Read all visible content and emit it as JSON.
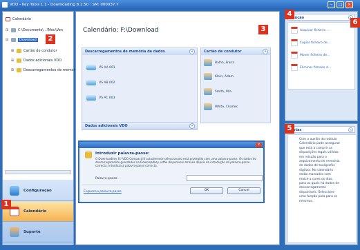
{
  "window": {
    "title": "VDO - Key Tools 1.1 - Downloading 8.1.50 : SM: 000037.7"
  },
  "tree": {
    "items": [
      {
        "label": "Calendário"
      },
      {
        "label": "C:\\Documents\\...\\Meu\\Ven"
      },
      {
        "label": "Download"
      },
      {
        "label": "Cartão de condutor"
      },
      {
        "label": "Dados adicionais VDO"
      },
      {
        "label": "Descarregamentos de memória"
      }
    ]
  },
  "nav": {
    "configuracao": "Configuração",
    "calendario": "Calendário",
    "suporte": "Suporte"
  },
  "main": {
    "title": "Calendário: F:\\Download",
    "memory": {
      "header": "Descarregamentos de memória de dados",
      "items": [
        "VS AA 001",
        "VS AB 002",
        "VS AC 003"
      ]
    },
    "cards": {
      "header": "Cartão de condutor",
      "items": [
        "Balha, Franz",
        "Klein, Adam",
        "Smith, Mia",
        "White, Charles"
      ]
    },
    "extra": {
      "header": "Dados adicionais VDO"
    }
  },
  "dialog": {
    "heading": "Introduzir palavra-passe:",
    "message": "O Downloadkey 8 / VDO Compact III actualmente seleccionado está protegido com uma palavra-passe. Os dados do descarregamento guardados no Downloadkey estão disponíveis através depois da introdução da palavra-passe correcta. Introduza a palavra-passe correcta.",
    "password_label": "Palavra-passe:",
    "forgot_link": "Esqueceu palavra-passe",
    "ok": "OK",
    "cancel": "Cancel"
  },
  "tasks": {
    "header": "Função",
    "items": [
      "Arquivar ficheiro ...",
      "Copiar ficheiro de...",
      "Mover ficheiro de...",
      "Eliminar ficheiro d..."
    ]
  },
  "notes": {
    "header": "Notas",
    "text": "Com o auxílio do módulo Calendário pode assegurar que está a cumprir as disposições legais válidas em relação para o arquivamento de memória de dados de tacógrafos digitais. No calendário estão marcados com realce a cores os dias, para os quais há dados de descarregamento disponíveis. Seleccione uma função para para os mesmos."
  },
  "badges": [
    "1",
    "2",
    "3",
    "4",
    "5",
    "6"
  ],
  "colors": {
    "titlebar": "#2764b8",
    "accent": "#d9321f",
    "selection": "#2b6ad1"
  }
}
